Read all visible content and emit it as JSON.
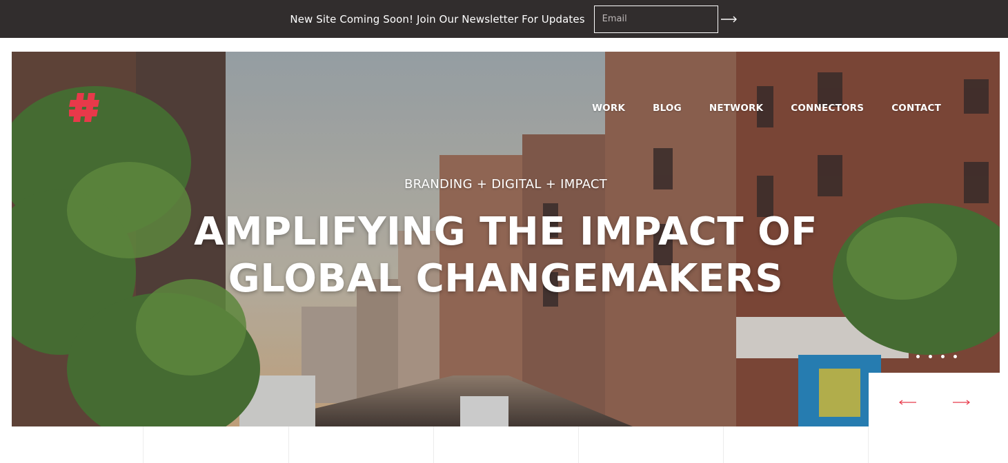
{
  "newsletter": {
    "text": "New Site Coming Soon! Join Our Newsletter For Updates",
    "email_placeholder": "Email",
    "submit_icon": "arrow-right-icon"
  },
  "brand": {
    "logo_icon": "hashtag-icon",
    "accent_color": "#e8394a"
  },
  "nav": {
    "items": [
      {
        "label": "WORK"
      },
      {
        "label": "BLOG"
      },
      {
        "label": "NETWORK"
      },
      {
        "label": "CONNECTORS"
      },
      {
        "label": "CONTACT"
      }
    ]
  },
  "hero": {
    "subtitle": "BRANDING + DIGITAL + IMPACT",
    "title_line1": "AMPLIFYING THE IMPACT OF",
    "title_line2": "GLOBAL CHANGEMAKERS",
    "slide_count": 4
  },
  "slider": {
    "prev_icon": "arrow-left-icon",
    "next_icon": "arrow-right-icon",
    "arrow_color": "#e8394a"
  },
  "colors": {
    "topbar_bg": "#312d2d",
    "text_light": "#ffffff"
  }
}
